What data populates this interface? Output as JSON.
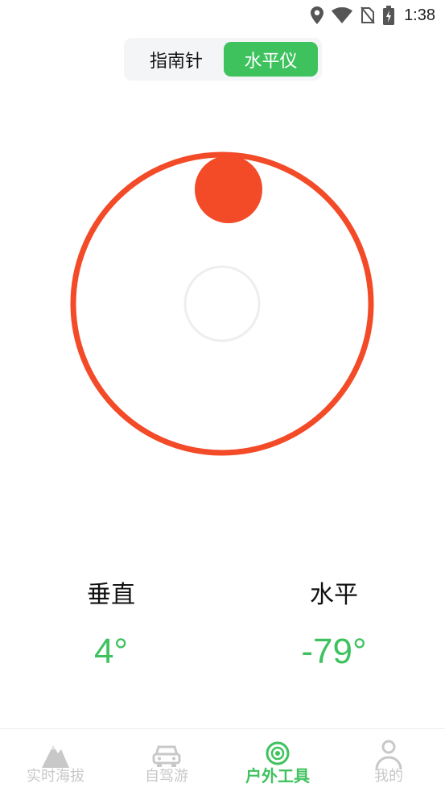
{
  "status_bar": {
    "time": "1:38",
    "icons": [
      "location-icon",
      "wifi-icon",
      "no-sim-icon",
      "battery-charging-icon"
    ]
  },
  "mode_switch": {
    "tabs": [
      {
        "label": "指南针",
        "active": false
      },
      {
        "label": "水平仪",
        "active": true
      }
    ]
  },
  "level": {
    "ring_color": "#f34a27",
    "bubble_color": "#f34a27",
    "center_ring_color": "#eeeeee"
  },
  "readouts": {
    "vertical": {
      "label": "垂直",
      "value": "4°"
    },
    "horizontal": {
      "label": "水平",
      "value": "-79°"
    }
  },
  "bottom_nav": {
    "items": [
      {
        "label": "实时海拔",
        "icon": "mountain-icon",
        "active": false
      },
      {
        "label": "自驾游",
        "icon": "car-icon",
        "active": false
      },
      {
        "label": "户外工具",
        "icon": "target-tool-icon",
        "active": true
      },
      {
        "label": "我的",
        "icon": "person-icon",
        "active": false
      }
    ]
  },
  "colors": {
    "accent": "#3ec25e",
    "inactive": "#c8c8c8",
    "level_red": "#f34a27"
  }
}
